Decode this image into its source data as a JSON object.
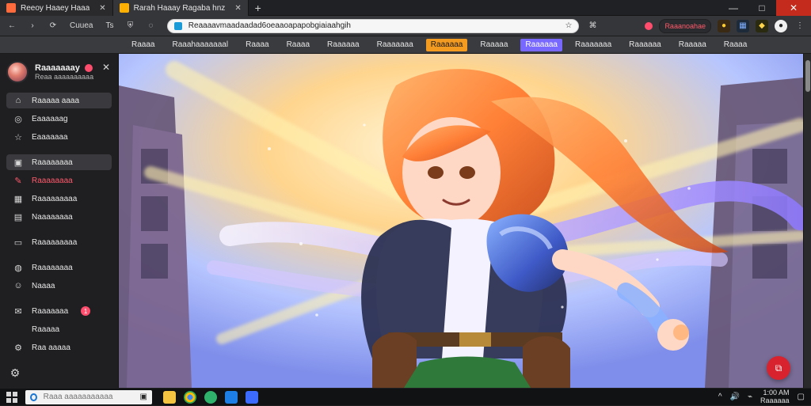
{
  "colors": {
    "tab_favicon_1": "#ff6b3d",
    "tab_favicon_2": "#ffb000",
    "bookmark_highlight_orange": "#f39a20",
    "bookmark_highlight_purple": "#7868ff",
    "alert_pink": "#ff4d6d",
    "fab_red": "#d8232f"
  },
  "tabs": [
    {
      "label": "Reeoy Haaey Haaa",
      "active": false,
      "favicon_icon": "flame-icon"
    },
    {
      "label": "Rarah Haaay Ragaba hnz",
      "active": true,
      "favicon_icon": "lock-icon"
    }
  ],
  "toolbar": {
    "left_buttons": [
      "Cuuea",
      "Ts"
    ],
    "address_value": "Reaaaavmaadaadad6oeaaoapapobgiaiaahgih",
    "extension_pill": "Raaanoahae"
  },
  "bookmarks": [
    {
      "label": "Raaaa",
      "style": "plain"
    },
    {
      "label": "Raaahaaaaaaal",
      "style": "plain"
    },
    {
      "label": "Raaaa",
      "style": "plain"
    },
    {
      "label": "Raaaa",
      "style": "plain"
    },
    {
      "label": "Raaaaaa",
      "style": "plain"
    },
    {
      "label": "Raaaaaaa",
      "style": "plain"
    },
    {
      "label": "Raaaaaa",
      "style": "orange"
    },
    {
      "label": "Raaaaa",
      "style": "plain"
    },
    {
      "label": "Raaaaaa",
      "style": "purple"
    },
    {
      "label": "Raaaaaaa",
      "style": "plain"
    },
    {
      "label": "Raaaaaa",
      "style": "plain"
    },
    {
      "label": "Raaaaa",
      "style": "plain"
    },
    {
      "label": "Raaaa",
      "style": "plain"
    }
  ],
  "sidebar": {
    "profile": {
      "name": "Raaaaaaay",
      "subtitle": "Reaa aaaaaaaaaa"
    },
    "items": [
      {
        "label": "Raaaaa aaaa",
        "icon": "home-icon",
        "selected": true,
        "alert": false,
        "section": false
      },
      {
        "label": "Eaaaaaag",
        "icon": "compass-icon",
        "selected": false,
        "alert": false,
        "section": false
      },
      {
        "label": "Eaaaaaaa",
        "icon": "star-icon",
        "selected": false,
        "alert": false,
        "section": false
      },
      {
        "label": "Raaaaaaaa",
        "icon": "image-icon",
        "selected": true,
        "alert": false,
        "section": true
      },
      {
        "label": "Raaaaaaaa",
        "icon": "brush-icon",
        "selected": false,
        "alert": true,
        "section": false
      },
      {
        "label": "Raaaaaaaaa",
        "icon": "grid-icon",
        "selected": false,
        "alert": false,
        "section": false
      },
      {
        "label": "Naaaaaaaa",
        "icon": "document-icon",
        "selected": false,
        "alert": false,
        "section": false
      },
      {
        "label": "Raaaaaaaaa",
        "icon": "folder-icon",
        "selected": false,
        "alert": false,
        "section": true
      },
      {
        "label": "Raaaaaaaa",
        "icon": "globe-icon",
        "selected": false,
        "alert": false,
        "section": true
      },
      {
        "label": "Naaaa",
        "icon": "users-icon",
        "selected": false,
        "alert": false,
        "section": false
      },
      {
        "label": "Raaaaaaa",
        "icon": "chat-icon",
        "selected": false,
        "alert": false,
        "section": true,
        "pill": "1"
      },
      {
        "label": "Raaaaa",
        "icon": "",
        "selected": false,
        "alert": false,
        "section": false
      },
      {
        "label": "Raa aaaaa",
        "icon": "settings-icon",
        "selected": false,
        "alert": false,
        "section": false
      }
    ]
  },
  "content": {
    "image_alt": "Anime-style warrior girl illustration",
    "fab_icon": "share-icon"
  },
  "taskbar": {
    "search_placeholder": "Raaa aaaaaaaaaaa",
    "clock_time": "1:00 AM",
    "clock_date": "Raaaaaa"
  }
}
